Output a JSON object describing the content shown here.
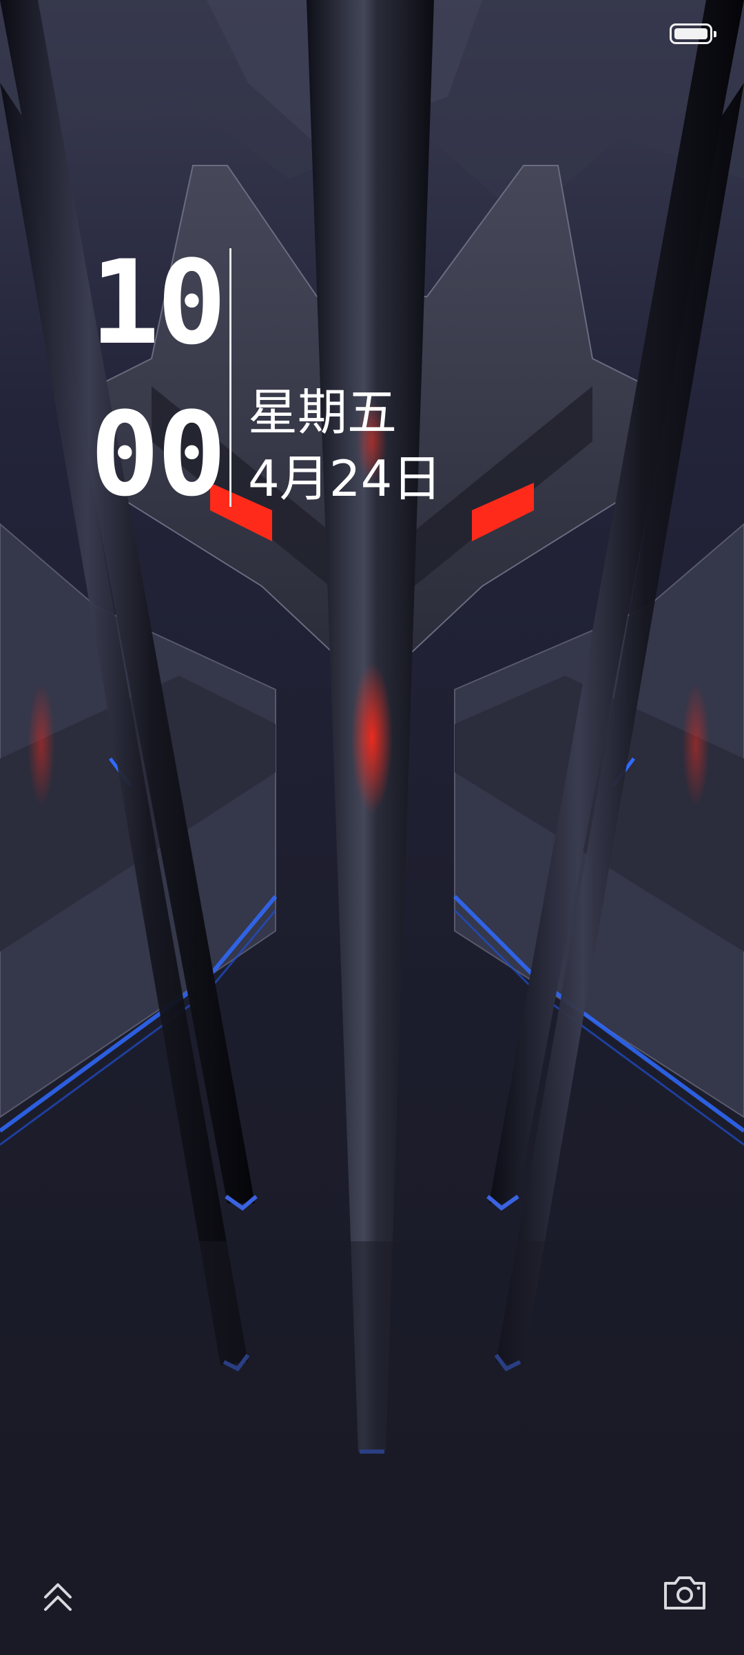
{
  "status_bar": {
    "battery_level": 1.0,
    "battery_icon": "battery-full-icon"
  },
  "clock": {
    "hour": "10",
    "minute": "00",
    "weekday": "星期五",
    "date": "4月24日"
  },
  "bottom_bar": {
    "left_icon": "double-chevron-up-icon",
    "right_icon": "camera-icon"
  },
  "colors": {
    "background": "#1a1b26",
    "accent_red": "#ff2a1a",
    "accent_blue": "#2f6bff",
    "text": "#ffffff"
  }
}
